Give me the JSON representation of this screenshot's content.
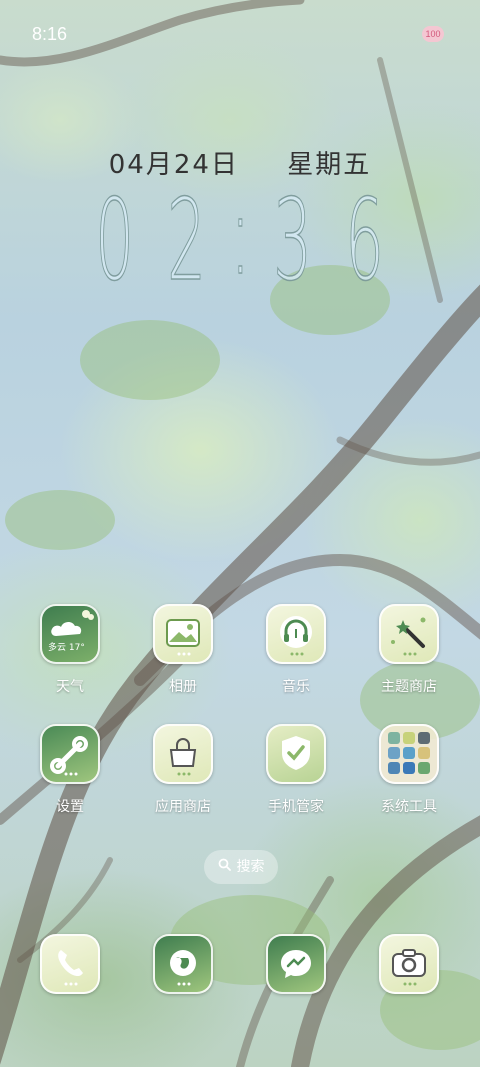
{
  "status_bar": {
    "time": "8:16",
    "battery": "100"
  },
  "lock_widget": {
    "date": "04月24日",
    "weekday": "星期五",
    "clock_digits": [
      "0",
      "2",
      "3",
      "6"
    ],
    "clock_separator": ":"
  },
  "apps_row1": [
    {
      "label": "天气",
      "icon": "weather-icon",
      "badge_text": "多云 17°"
    },
    {
      "label": "相册",
      "icon": "gallery-icon"
    },
    {
      "label": "音乐",
      "icon": "music-icon"
    },
    {
      "label": "主题商店",
      "icon": "theme-store-icon"
    }
  ],
  "apps_row2": [
    {
      "label": "设置",
      "icon": "settings-icon"
    },
    {
      "label": "应用商店",
      "icon": "app-store-icon"
    },
    {
      "label": "手机管家",
      "icon": "phone-manager-icon"
    },
    {
      "label": "系统工具",
      "icon": "folder-icon"
    }
  ],
  "search": {
    "label": "搜索",
    "icon": "search-icon"
  },
  "dock": [
    {
      "icon": "phone-icon"
    },
    {
      "icon": "browser-icon"
    },
    {
      "icon": "messages-icon"
    },
    {
      "icon": "camera-icon"
    }
  ],
  "colors": {
    "icon_bg": "#e6ecc2",
    "icon_accent": "#4d8b52",
    "label_text": "#ffffff"
  }
}
